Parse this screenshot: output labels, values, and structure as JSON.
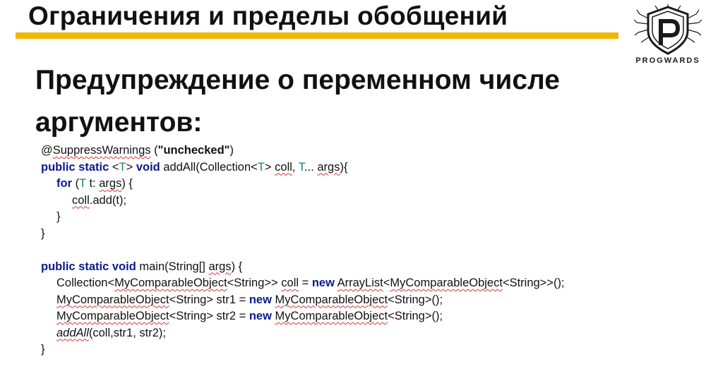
{
  "header": {
    "title": "Ограничения  и пределы обобщений",
    "accent_color": "#f2b705"
  },
  "logo": {
    "icon": "progwards-shield-icon",
    "text": "PROGWARDS"
  },
  "slide": {
    "heading": "Предупреждение о переменном числе аргументов:"
  },
  "code": {
    "l1": {
      "a": "@",
      "b": "SuppressWarnings",
      "c": " (",
      "d": "\"unchecked\"",
      "e": ")"
    },
    "l2": {
      "a": "public static",
      "b": " <",
      "c": "T",
      "d": "> ",
      "e": "void",
      "f": " addAll(Collection<",
      "g": "T",
      "h": "> ",
      "i": "coll",
      "j": ", ",
      "k": "T",
      "l": "... ",
      "m": "args",
      "n": "){"
    },
    "l3": {
      "a": "for",
      "b": " (",
      "c": "T",
      "d": " t: ",
      "e": "args",
      "f": ") {"
    },
    "l4": {
      "a": "coll",
      "b": ".add(t);"
    },
    "l5": "}",
    "l6": "}",
    "l8": {
      "a": "public static void",
      "b": " main(String[] ",
      "c": "args",
      "d": ") {"
    },
    "l9": {
      "a": "Collection<",
      "b": "MyComparableObject",
      "c": "<String>> ",
      "d": "coll",
      "e": " = ",
      "f": "new",
      "g": " ",
      "h": "ArrayList",
      "i": "<",
      "j": "MyComparableObject",
      "k": "<String>>();"
    },
    "l10": {
      "a": "MyComparableObject",
      "b": "<String> str1 = ",
      "c": "new",
      "d": " ",
      "e": "MyComparableObject",
      "f": "<String>();"
    },
    "l11": {
      "a": "MyComparableObject",
      "b": "<String> str2 = ",
      "c": "new",
      "d": " ",
      "e": "MyComparableObject",
      "f": "<String>();"
    },
    "l12": {
      "a": "addAll",
      "b": "(coll,str1, str2);"
    },
    "l13": "}"
  }
}
